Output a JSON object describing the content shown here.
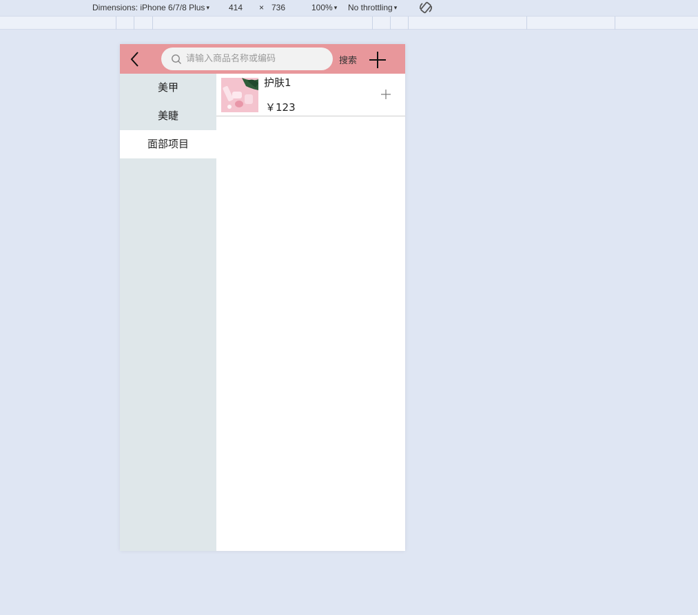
{
  "devtools": {
    "device_label": "Dimensions: iPhone 6/7/8 Plus",
    "width": "414",
    "times": "×",
    "height": "736",
    "zoom": "100%",
    "throttling": "No throttling",
    "dropdown_glyph": "▾"
  },
  "header": {
    "search_placeholder": "请输入商品名称或编码",
    "search_label": "搜索"
  },
  "categories": [
    {
      "label": "美甲"
    },
    {
      "label": "美睫"
    },
    {
      "label": "面部项目"
    }
  ],
  "active_category": "面部项目",
  "products": [
    {
      "name": "护肤1",
      "price": "￥123"
    }
  ],
  "colors": {
    "header_bg": "#e8979b",
    "sidebar_bg": "#dfe7ea",
    "page_bg": "#dfe6f3"
  }
}
